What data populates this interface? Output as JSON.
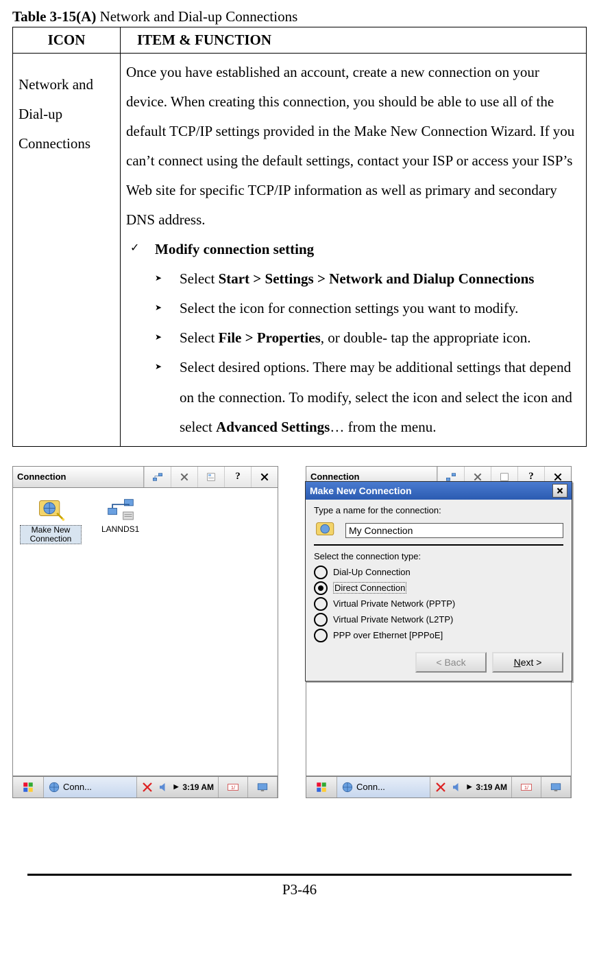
{
  "caption": {
    "label": "Table 3-15(A)",
    "title": "Network and Dial-up Connections"
  },
  "headers": {
    "icon": "ICON",
    "func": "ITEM & FUNCTION"
  },
  "row": {
    "icon_label": "Network and Dial-up Connections",
    "intro": "Once you have established an account, create a new connection on your device. When creating this connection, you should be able to use all of the default TCP/IP settings provided in the Make New Connection Wizard. If you can’t connect using the default settings, contact your ISP or access your ISP’s Web site for specific TCP/IP information as well as primary and secondary DNS address.",
    "check_label": "Modify connection setting",
    "bullets": {
      "b1_pre": "Select ",
      "b1_bold": "Start > Settings > Network and Dialup Connections",
      "b2": "Select the icon for connection settings you want to modify.",
      "b3_pre": "Select ",
      "b3_bold": "File > Properties",
      "b3_post": ", or double- tap the appropriate icon.",
      "b4_pre": "Select desired options. There may be additional settings that depend on the connection. To modify, select the icon and select the icon and select ",
      "b4_bold": "Advanced Settings",
      "b4_post": "… from the menu."
    }
  },
  "screen1": {
    "title": "Connection",
    "icons": {
      "make_new": "Make New Connection",
      "lan": "LANNDS1"
    }
  },
  "screen2": {
    "title_bg": "Connection",
    "dialog_title": "Make New Connection",
    "prompt_name": "Type a name for the connection:",
    "conn_name": "My Connection",
    "prompt_type": "Select the connection type:",
    "options": {
      "o1": "Dial-Up Connection",
      "o2": "Direct Connection",
      "o3": "Virtual Private Network (PPTP)",
      "o4": "Virtual Private Network (L2TP)",
      "o5": "PPP over Ethernet [PPPoE]"
    },
    "btn_back": "<  Back",
    "btn_next": "Next >"
  },
  "taskbar": {
    "app_label": "Conn...",
    "time": "3:19 AM"
  },
  "page_number": "P3-46"
}
